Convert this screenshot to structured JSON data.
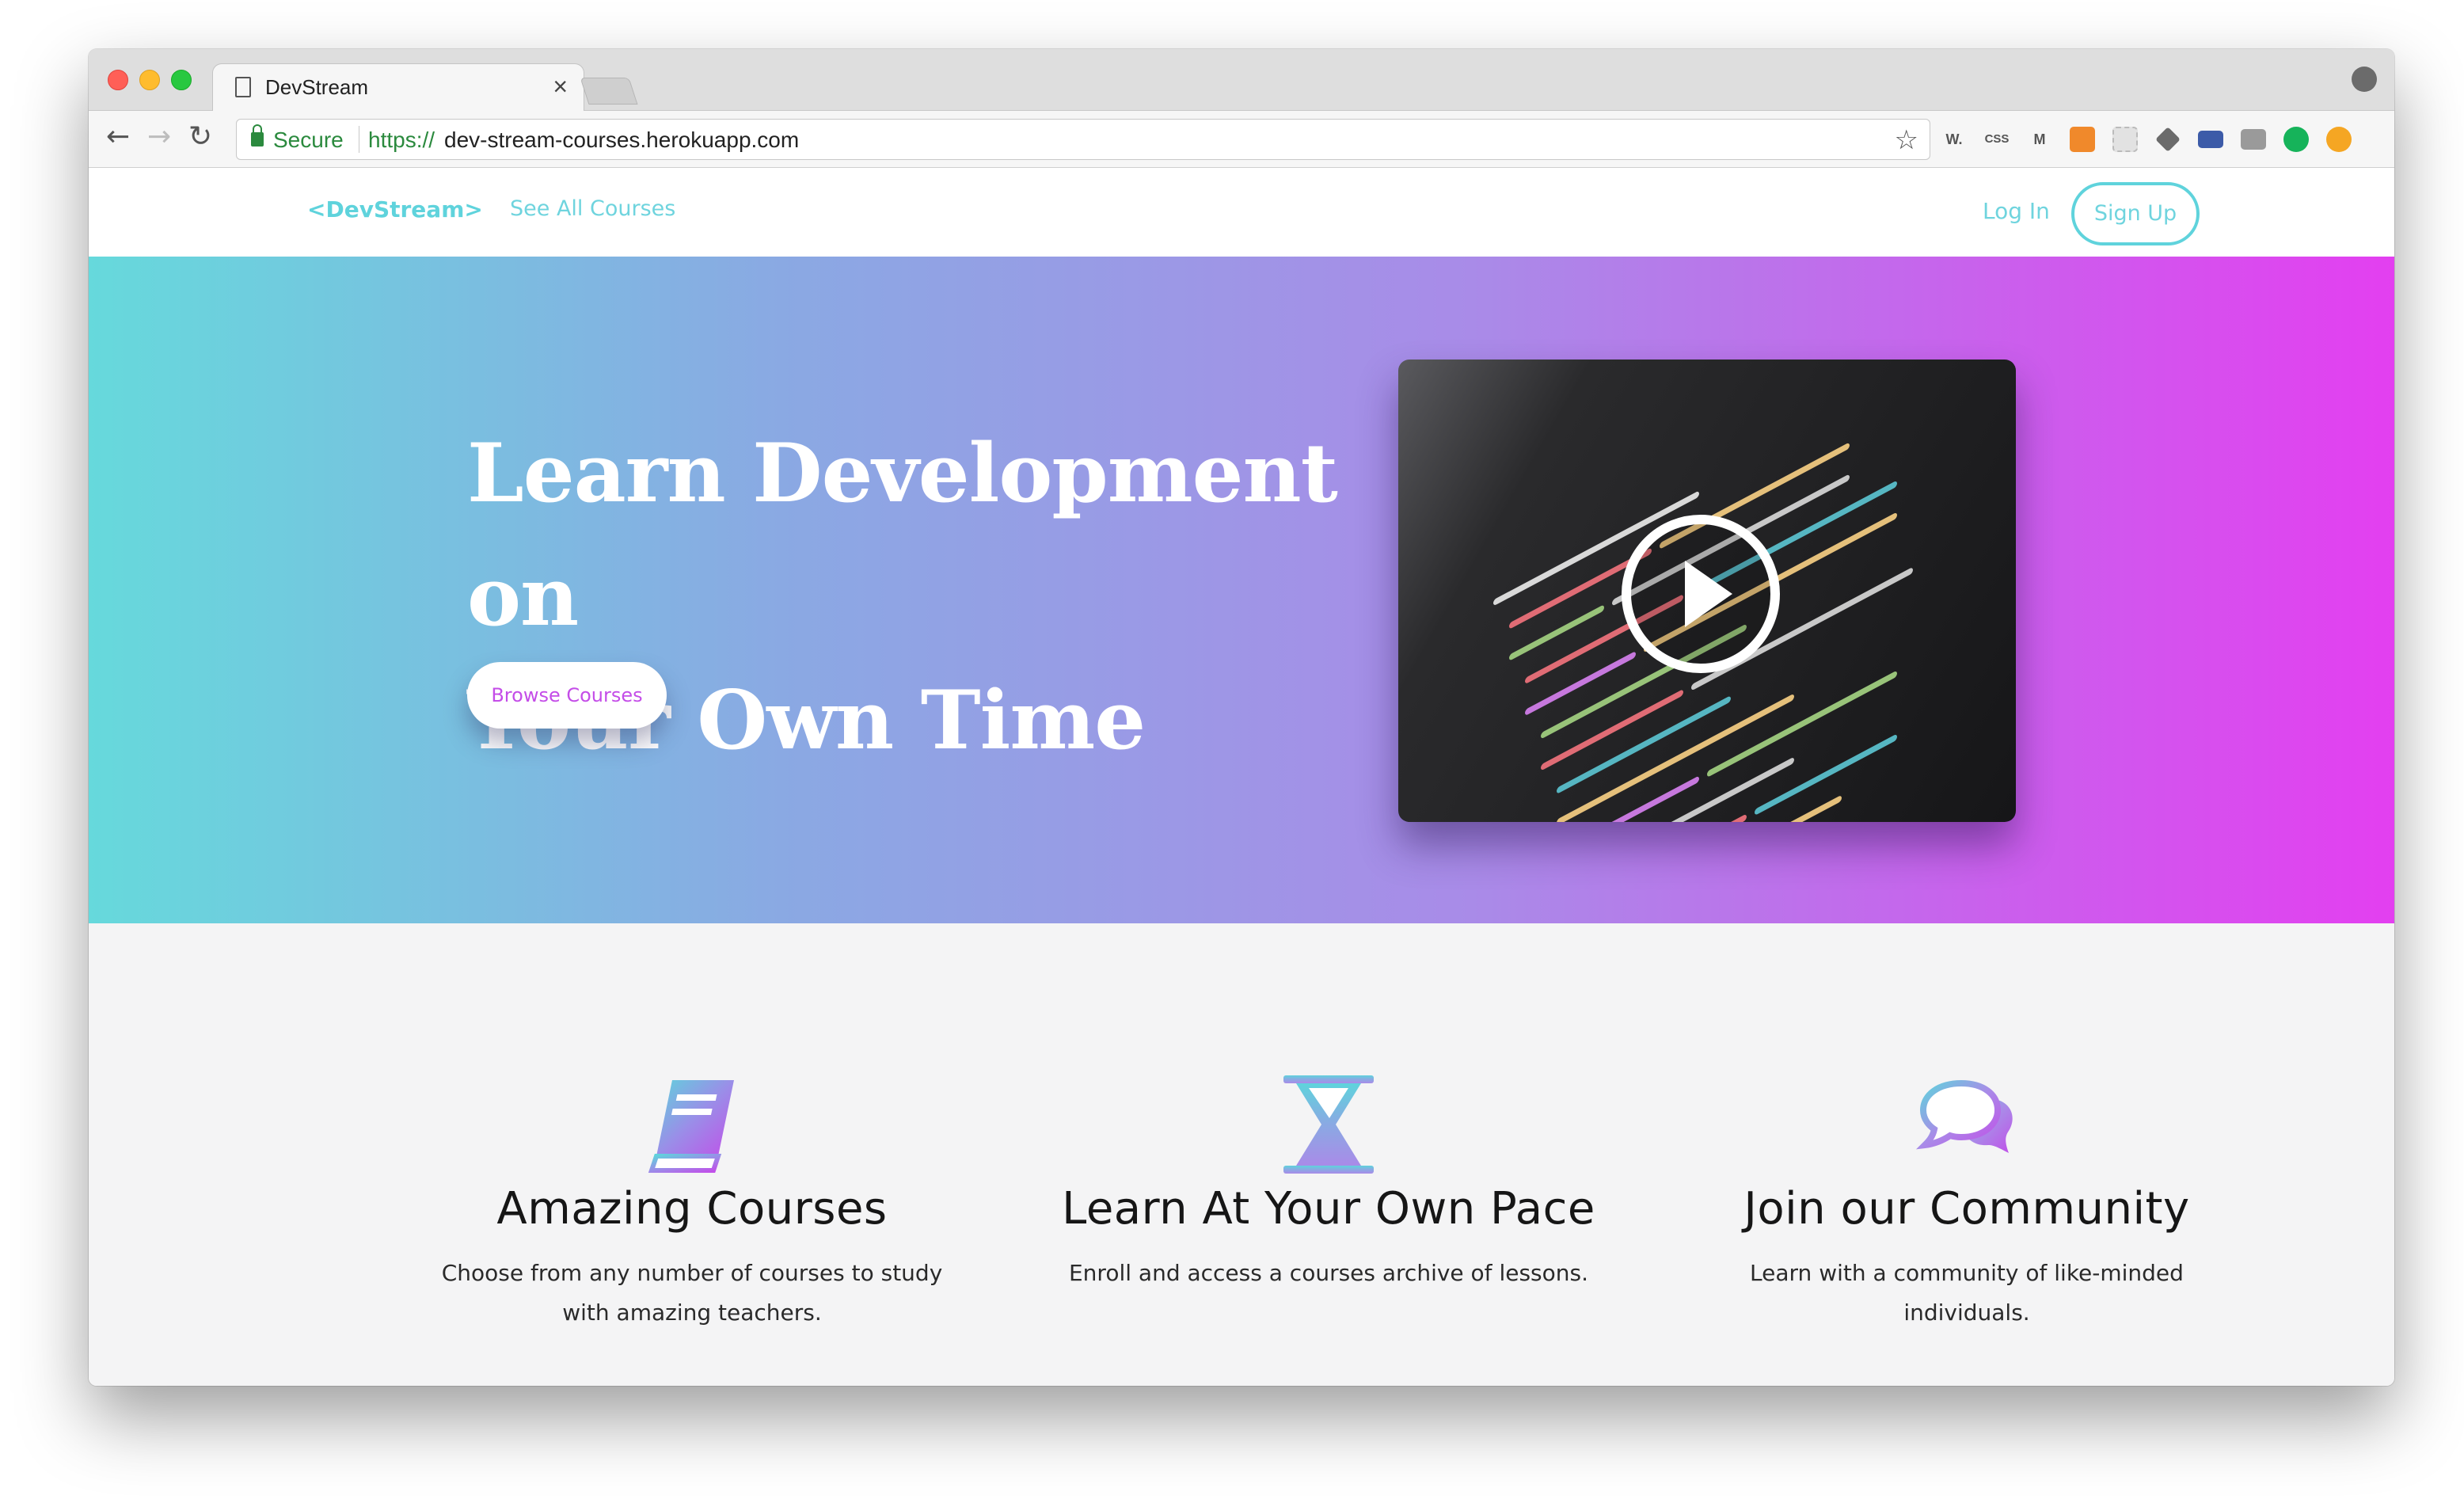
{
  "browser": {
    "tab_title": "DevStream",
    "tab_close": "×",
    "secure_label": "Secure",
    "url_protocol": "https://",
    "url_host": "dev-stream-courses.herokuapp.com",
    "nav_back": "←",
    "nav_forward": "→",
    "nav_reload": "↻",
    "bookmark_star": "☆",
    "extensions": [
      {
        "icon": "wappalyzer-icon",
        "label": "W."
      },
      {
        "icon": "css-icon",
        "label": "CSS"
      },
      {
        "icon": "m-icon",
        "label": "M"
      }
    ]
  },
  "site_nav": {
    "brand": "<DevStream>",
    "see_all_courses": "See All Courses",
    "log_in": "Log In",
    "sign_up": "Sign Up"
  },
  "hero": {
    "title_line_1": "Learn Development on",
    "title_line_2": "Your Own Time",
    "cta": "Browse Courses"
  },
  "features": [
    {
      "icon": "book-icon",
      "title": "Amazing Courses",
      "text": "Choose from any number of courses to study with amazing teachers."
    },
    {
      "icon": "hourglass-icon",
      "title": "Learn At Your Own Pace",
      "text": "Enroll and access a courses archive of lessons."
    },
    {
      "icon": "chat-bubbles-icon",
      "title": "Join our Community",
      "text": "Learn with a community of like-minded individuals."
    }
  ],
  "colors": {
    "accent_teal": "#5fd3dc",
    "accent_magenta": "#e33ff0",
    "secure_green": "#2b8a3e"
  }
}
